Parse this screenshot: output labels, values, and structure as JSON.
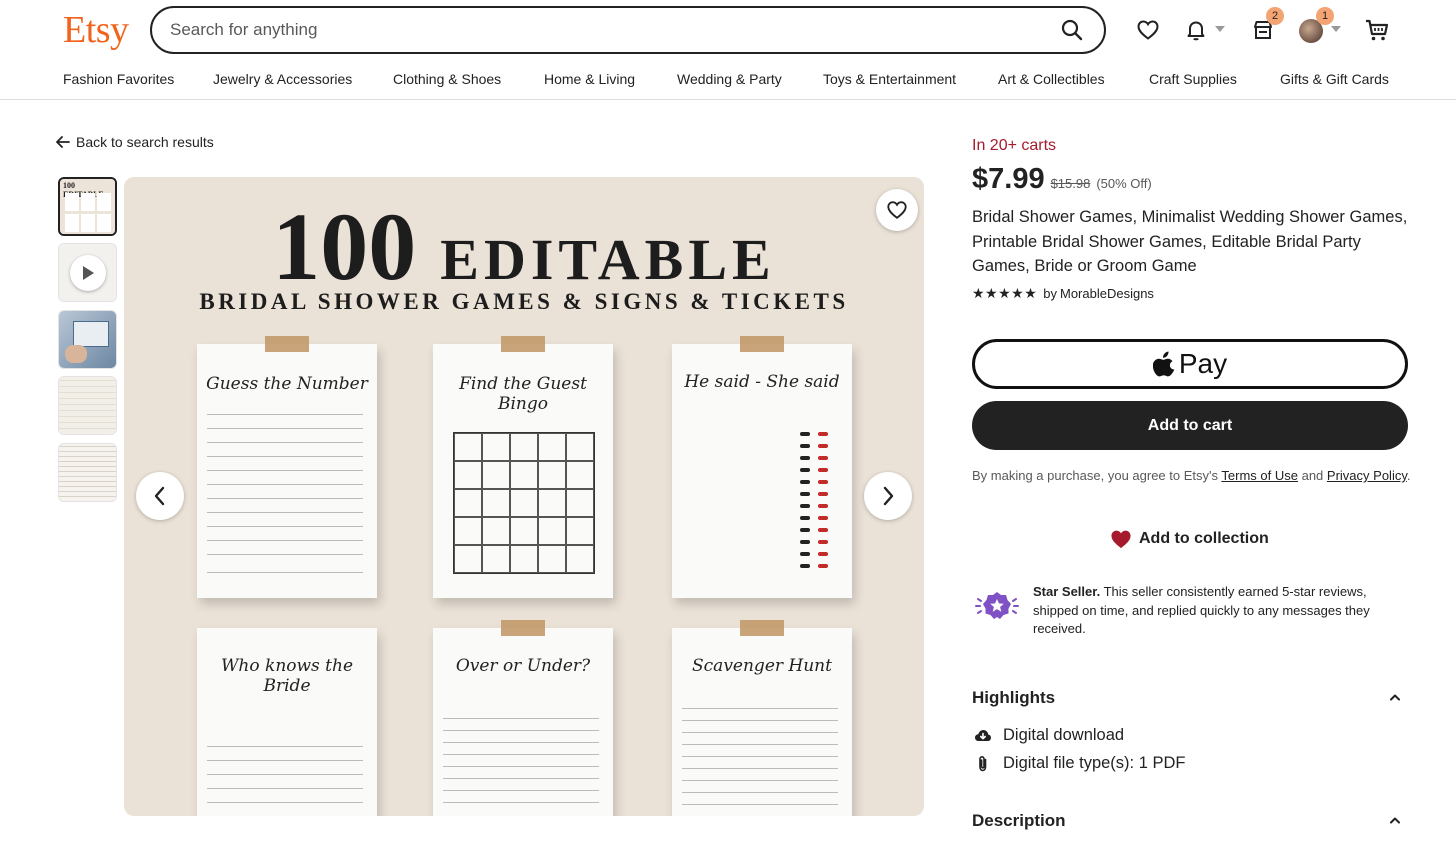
{
  "header": {
    "logo": "Etsy",
    "search_placeholder": "Search for anything",
    "cart_badge": "2",
    "profile_badge": "1"
  },
  "nav": {
    "items": [
      "Fashion Favorites",
      "Jewelry & Accessories",
      "Clothing & Shoes",
      "Home & Living",
      "Wedding & Party",
      "Toys & Entertainment",
      "Art & Collectibles",
      "Craft Supplies",
      "Gifts & Gift Cards"
    ]
  },
  "gallery": {
    "back_label": "Back to search results",
    "image_title_number": "100",
    "image_title_word": "EDITABLE",
    "image_subtitle": "BRIDAL SHOWER GAMES & SIGNS & TICKETS",
    "cards": [
      "Guess the Number",
      "Find the Guest Bingo",
      "He said - She said",
      "Who knows the Bride",
      "Over or Under?",
      "Scavenger Hunt"
    ]
  },
  "product": {
    "in_carts": "In 20+ carts",
    "price": "$7.99",
    "original_price": "$15.98",
    "discount": "(50% Off)",
    "title": "Bridal Shower Games, Minimalist Wedding Shower Games, Printable Bridal Shower Games, Editable Bridal Party Games, Bride or Groom Game",
    "rating": 5,
    "stars_text": "★★★★★",
    "seller_prefix": "by",
    "seller": "MorableDesigns",
    "apple_pay_label": "Pay",
    "add_to_cart": "Add to cart",
    "terms_prefix": "By making a purchase, you agree to Etsy's",
    "terms_link": "Terms of Use",
    "terms_and": "and",
    "privacy_link": "Privacy Policy",
    "terms_suffix": ".",
    "add_to_collection": "Add to collection",
    "star_seller_title": "Star Seller.",
    "star_seller_text": "This seller consistently earned 5-star reviews, shipped on time, and replied quickly to any messages they received."
  },
  "highlights": {
    "heading": "Highlights",
    "items": [
      "Digital download",
      "Digital file type(s): 1 PDF"
    ]
  },
  "description": {
    "heading": "Description"
  },
  "colors": {
    "brand_orange": "#f1641e",
    "carts_red": "#a61a2e",
    "heart_red": "#a61a2e",
    "star_seller_purple": "#7f51c4",
    "badge_peach": "#f4a373"
  }
}
